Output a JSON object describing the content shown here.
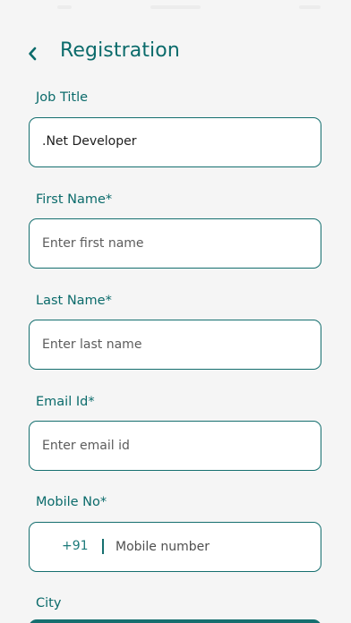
{
  "header": {
    "title": "Registration",
    "back_icon": "chevron-left-icon"
  },
  "form": {
    "job_title": {
      "label": "Job Title",
      "value": ".Net Developer"
    },
    "first_name": {
      "label": "First Name*",
      "placeholder": "Enter first name"
    },
    "last_name": {
      "label": "Last Name*",
      "placeholder": "Enter last name"
    },
    "email": {
      "label": "Email Id*",
      "placeholder": "Enter email id"
    },
    "mobile": {
      "label": "Mobile No*",
      "country_code": "+91",
      "placeholder": "Mobile number"
    },
    "city": {
      "label": "City"
    }
  },
  "colors": {
    "accent": "#0b6b6b",
    "border": "#156f6f",
    "background": "#f5f5f5",
    "field_background": "#ffffff"
  }
}
